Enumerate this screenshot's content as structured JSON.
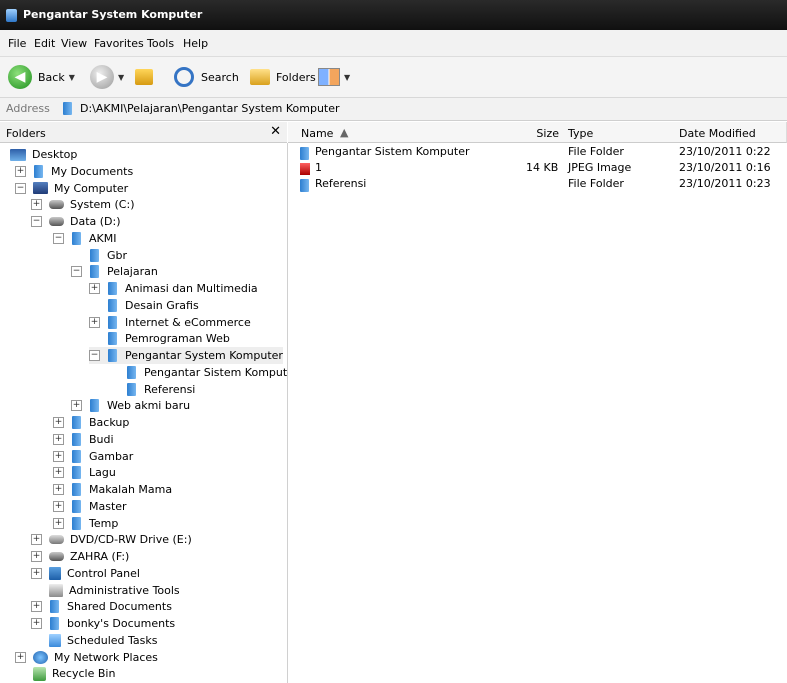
{
  "window": {
    "title": "Pengantar System Komputer"
  },
  "menu": [
    "File",
    "Edit",
    "View",
    "Favorites",
    "Tools",
    "Help"
  ],
  "toolbar": {
    "back_label": "Back",
    "search_label": "Search",
    "folders_label": "Folders"
  },
  "address": {
    "label": "Address",
    "path": "D:\\AKMI\\Pelajaran\\Pengantar System Komputer"
  },
  "folders_panel": {
    "title": "Folders",
    "close": "✕",
    "tree": [
      {
        "label": "Desktop",
        "icon": "desktop-icon",
        "expander": ""
      },
      {
        "label": "My Documents",
        "icon": "folder-icon",
        "expander": "+"
      },
      {
        "label": "My Computer",
        "icon": "computer-icon",
        "expander": "−"
      },
      {
        "label": "System (C:)",
        "icon": "drive-icon",
        "expander": "+"
      },
      {
        "label": "Data (D:)",
        "icon": "drive-icon",
        "expander": "−"
      },
      {
        "label": "AKMI",
        "icon": "folder-icon",
        "expander": "−"
      },
      {
        "label": "Gbr",
        "icon": "folder-icon",
        "expander": ""
      },
      {
        "label": "Pelajaran",
        "icon": "folder-icon",
        "expander": "−"
      },
      {
        "label": "Animasi dan Multimedia",
        "icon": "folder-icon",
        "expander": "+"
      },
      {
        "label": "Desain Grafis",
        "icon": "folder-icon",
        "expander": ""
      },
      {
        "label": "Internet & eCommerce",
        "icon": "folder-icon",
        "expander": "+"
      },
      {
        "label": "Pemrograman Web",
        "icon": "folder-icon",
        "expander": ""
      },
      {
        "label": "Pengantar System Komputer",
        "icon": "folder-icon",
        "expander": "−"
      },
      {
        "label": "Pengantar Sistem Komputer",
        "icon": "folder-icon",
        "expander": ""
      },
      {
        "label": "Referensi",
        "icon": "folder-icon",
        "expander": ""
      },
      {
        "label": "Web akmi baru",
        "icon": "folder-icon",
        "expander": "+"
      },
      {
        "label": "Backup",
        "icon": "folder-icon",
        "expander": "+"
      },
      {
        "label": "Budi",
        "icon": "folder-icon",
        "expander": "+"
      },
      {
        "label": "Gambar",
        "icon": "folder-icon",
        "expander": "+"
      },
      {
        "label": "Lagu",
        "icon": "folder-icon",
        "expander": "+"
      },
      {
        "label": "Makalah Mama",
        "icon": "folder-icon",
        "expander": "+"
      },
      {
        "label": "Master",
        "icon": "folder-icon",
        "expander": "+"
      },
      {
        "label": "Temp",
        "icon": "folder-icon",
        "expander": "+"
      },
      {
        "label": "DVD/CD-RW Drive (E:)",
        "icon": "dvd-icon",
        "expander": "+"
      },
      {
        "label": "ZAHRA (F:)",
        "icon": "drive-icon",
        "expander": "+"
      },
      {
        "label": "Control Panel",
        "icon": "control-panel-icon",
        "expander": "+"
      },
      {
        "label": "Administrative Tools",
        "icon": "admin-tools-icon",
        "expander": ""
      },
      {
        "label": "Shared Documents",
        "icon": "folder-icon",
        "expander": "+"
      },
      {
        "label": "bonky's Documents",
        "icon": "folder-icon",
        "expander": "+"
      },
      {
        "label": "Scheduled Tasks",
        "icon": "tasks-icon",
        "expander": ""
      },
      {
        "label": "My Network Places",
        "icon": "network-icon",
        "expander": "+"
      },
      {
        "label": "Recycle Bin",
        "icon": "recycle-bin-icon",
        "expander": ""
      }
    ]
  },
  "file_list": {
    "columns": {
      "name": "Name",
      "size": "Size",
      "type": "Type",
      "date": "Date Modified"
    },
    "rows": [
      {
        "name": "Pengantar Sistem Komputer",
        "size": "",
        "type": "File Folder",
        "date": "23/10/2011 0:22",
        "icon": "folder-icon"
      },
      {
        "name": "1",
        "size": "14 KB",
        "type": "JPEG Image",
        "date": "23/10/2011 0:16",
        "icon": "jpeg-icon"
      },
      {
        "name": "Referensi",
        "size": "",
        "type": "File Folder",
        "date": "23/10/2011 0:23",
        "icon": "folder-icon"
      }
    ]
  }
}
